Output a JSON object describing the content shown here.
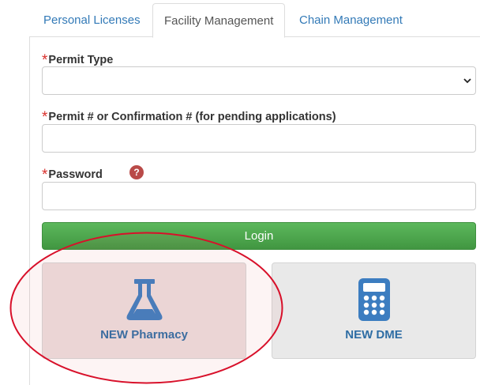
{
  "tabs": [
    {
      "label": "Personal Licenses",
      "active": false
    },
    {
      "label": "Facility Management",
      "active": true
    },
    {
      "label": "Chain Management",
      "active": false
    }
  ],
  "form": {
    "required_marker": "*",
    "permit_type": {
      "label": "Permit Type",
      "value": ""
    },
    "permit_number": {
      "label": "Permit # or Confirmation # (for pending applications)",
      "value": ""
    },
    "password": {
      "label": "Password",
      "value": "",
      "help_icon": "question-circle-icon",
      "help_glyph": "?"
    },
    "login_label": "Login"
  },
  "tiles": [
    {
      "label": "NEW Pharmacy",
      "icon": "flask-icon"
    },
    {
      "label": "NEW DME",
      "icon": "calculator-icon"
    }
  ],
  "colors": {
    "link": "#337ab7",
    "required": "#d9302c",
    "login_button": "#4cae4c",
    "tile_text": "#2e6da4",
    "icon": "#3c7dc0",
    "highlight_ring": "#d8102a"
  }
}
